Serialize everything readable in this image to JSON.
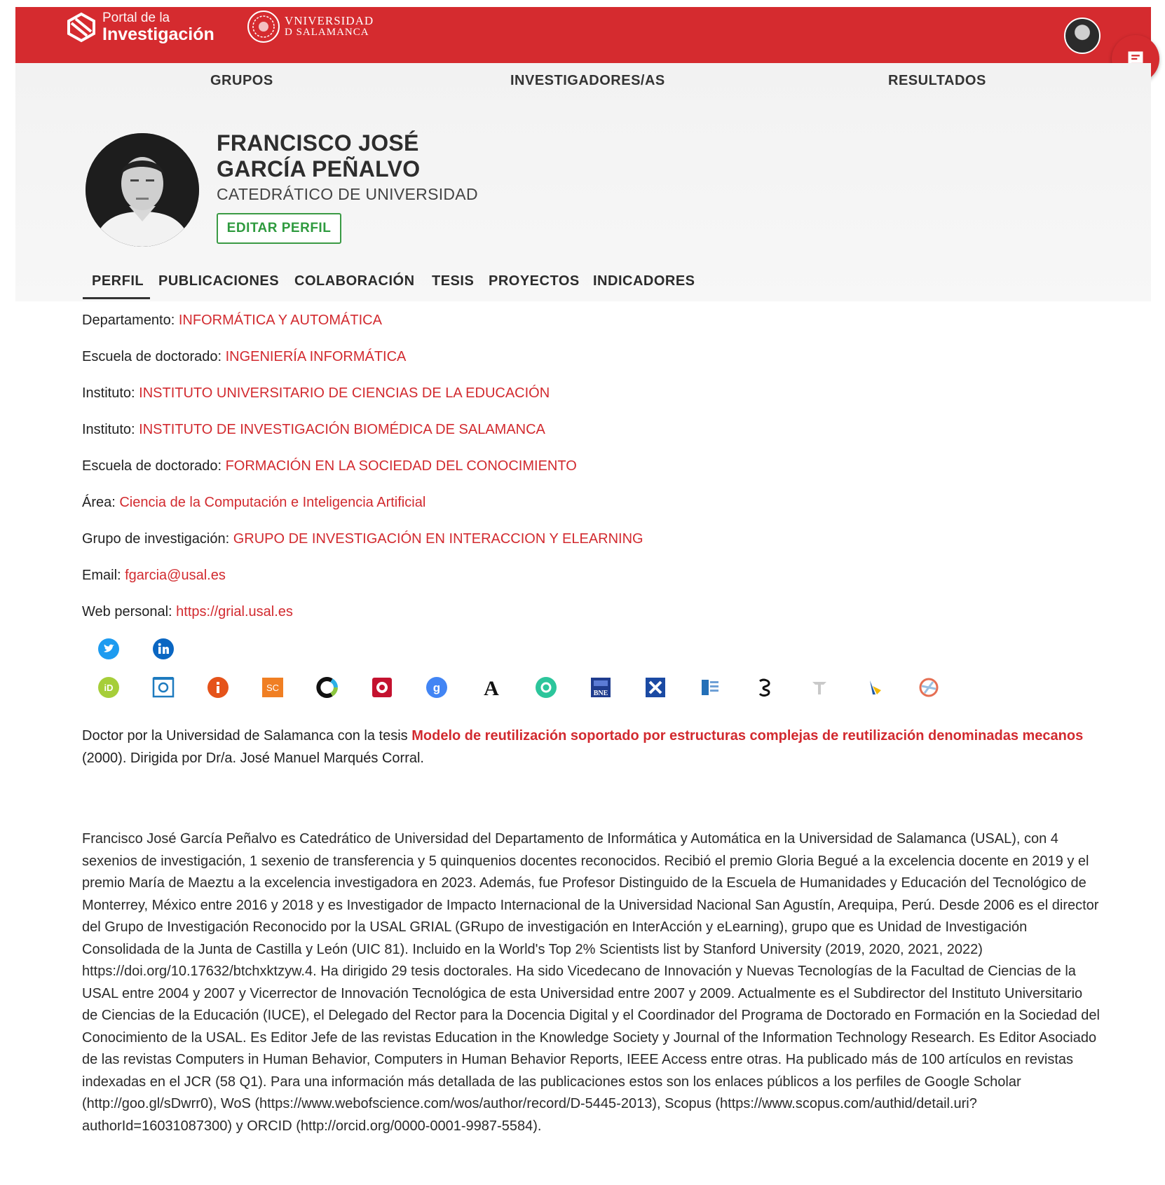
{
  "header": {
    "portal_line1": "Portal de la",
    "portal_line2": "Investigación",
    "usal_line1": "VNIVERSIDAD",
    "usal_line2": "D SALAMANCA"
  },
  "nav": {
    "groups": "GRUPOS",
    "researchers": "INVESTIGADORES/AS",
    "results": "RESULTADOS"
  },
  "profile": {
    "name_line1": "FRANCISCO JOSÉ",
    "name_line2": "GARCÍA PEÑALVO",
    "role": "CATEDRÁTICO DE UNIVERSIDAD",
    "edit_label": "EDITAR PERFIL"
  },
  "tabs": [
    "PERFIL",
    "PUBLICACIONES",
    "COLABORACIÓN",
    "TESIS",
    "PROYECTOS",
    "INDICADORES"
  ],
  "info": [
    {
      "label": "Departamento: ",
      "value": "INFORMÁTICA Y AUTOMÁTICA"
    },
    {
      "label": "Escuela de doctorado: ",
      "value": "INGENIERÍA INFORMÁTICA"
    },
    {
      "label": "Instituto: ",
      "value": "INSTITUTO UNIVERSITARIO DE CIENCIAS DE LA EDUCACIÓN"
    },
    {
      "label": "Instituto: ",
      "value": "INSTITUTO DE INVESTIGACIÓN BIOMÉDICA DE SALAMANCA"
    },
    {
      "label": "Escuela de doctorado: ",
      "value": "FORMACIÓN EN LA SOCIEDAD DEL CONOCIMIENTO"
    },
    {
      "label": "Área: ",
      "value": "Ciencia de la Computación e Inteligencia Artificial"
    },
    {
      "label": "Grupo de investigación: ",
      "value": "GRUPO DE INVESTIGACIÓN EN INTERACCION Y ELEARNING"
    },
    {
      "label": "Email: ",
      "value": "fgarcia@usal.es"
    },
    {
      "label": "Web personal: ",
      "value": "https://grial.usal.es"
    }
  ],
  "social_icons": [
    "twitter-icon",
    "linkedin-icon"
  ],
  "profile_icons": [
    "orcid-icon",
    "scopus-icon",
    "researchgate-icon",
    "scholar-icon",
    "crossref-icon",
    "dialnet-icon",
    "google-scholar-icon",
    "academia-icon",
    "publons-icon",
    "bne-icon",
    "webofscience-icon",
    "mendeley-icon",
    "semantic-scholar-icon",
    "gredos-icon",
    "loop-icon",
    "figshare-icon"
  ],
  "thesis": {
    "prefix": "Doctor por la Universidad de Salamanca con la tesis ",
    "title": "Modelo de reutilización soportado por estructuras complejas de reutilización denominadas mecanos",
    "suffix": " (2000). Dirigida por Dr/a. José Manuel Marqués Corral."
  },
  "bio": "Francisco José García Peñalvo es Catedrático de Universidad del Departamento de Informática y Automática en la Universidad de Salamanca (USAL), con 4 sexenios de investigación, 1 sexenio de transferencia y 5 quinquenios docentes reconocidos. Recibió el premio Gloria Begué a la excelencia docente en 2019 y el premio María de Maeztu a la excelencia investigadora en 2023. Además, fue Profesor Distinguido de la Escuela de Humanidades y Educación del Tecnológico de Monterrey, México entre 2016 y 2018 y es Investigador de Impacto Internacional de la Universidad Nacional San Agustín, Arequipa, Perú. Desde 2006 es el director del Grupo de Investigación Reconocido por la USAL GRIAL (GRupo de investigación en InterAcción y eLearning), grupo que es Unidad de Investigación Consolidada de la Junta de Castilla y León (UIC 81). Incluido en la World's Top 2% Scientists list by Stanford University (2019, 2020, 2021, 2022) https://doi.org/10.17632/btchxktzyw.4. Ha dirigido 29 tesis doctorales. Ha sido Vicedecano de Innovación y Nuevas Tecnologías de la Facultad de Ciencias de la USAL entre 2004 y 2007 y Vicerrector de Innovación Tecnológica de esta Universidad entre 2007 y 2009. Actualmente es el Subdirector del Instituto Universitario de Ciencias de la Educación (IUCE), el Delegado del Rector para la Docencia Digital y el Coordinador del Programa de Doctorado en Formación en la Sociedad del Conocimiento de la USAL. Es Editor Jefe de las revistas Education in the Knowledge Society y Journal of the Information Technology Research. Es Editor Asociado de las revistas Computers in Human Behavior, Computers in Human Behavior Reports, IEEE Access entre otras. Ha publicado más de 100 artículos en revistas indexadas en el JCR (58 Q1). Para una información más detallada de las publicaciones estos son los enlaces públicos a los perfiles de Google Scholar (http://goo.gl/sDwrr0), WoS (https://www.webofscience.com/wos/author/record/D-5445-2013), Scopus (https://www.scopus.com/authid/detail.uri?authorId=16031087300) y ORCID (http://orcid.org/0000-0001-9987-5584).",
  "colors": {
    "brand_red": "#d52b2f",
    "link_red": "#d22a2f",
    "edit_green": "#3a9a44"
  }
}
